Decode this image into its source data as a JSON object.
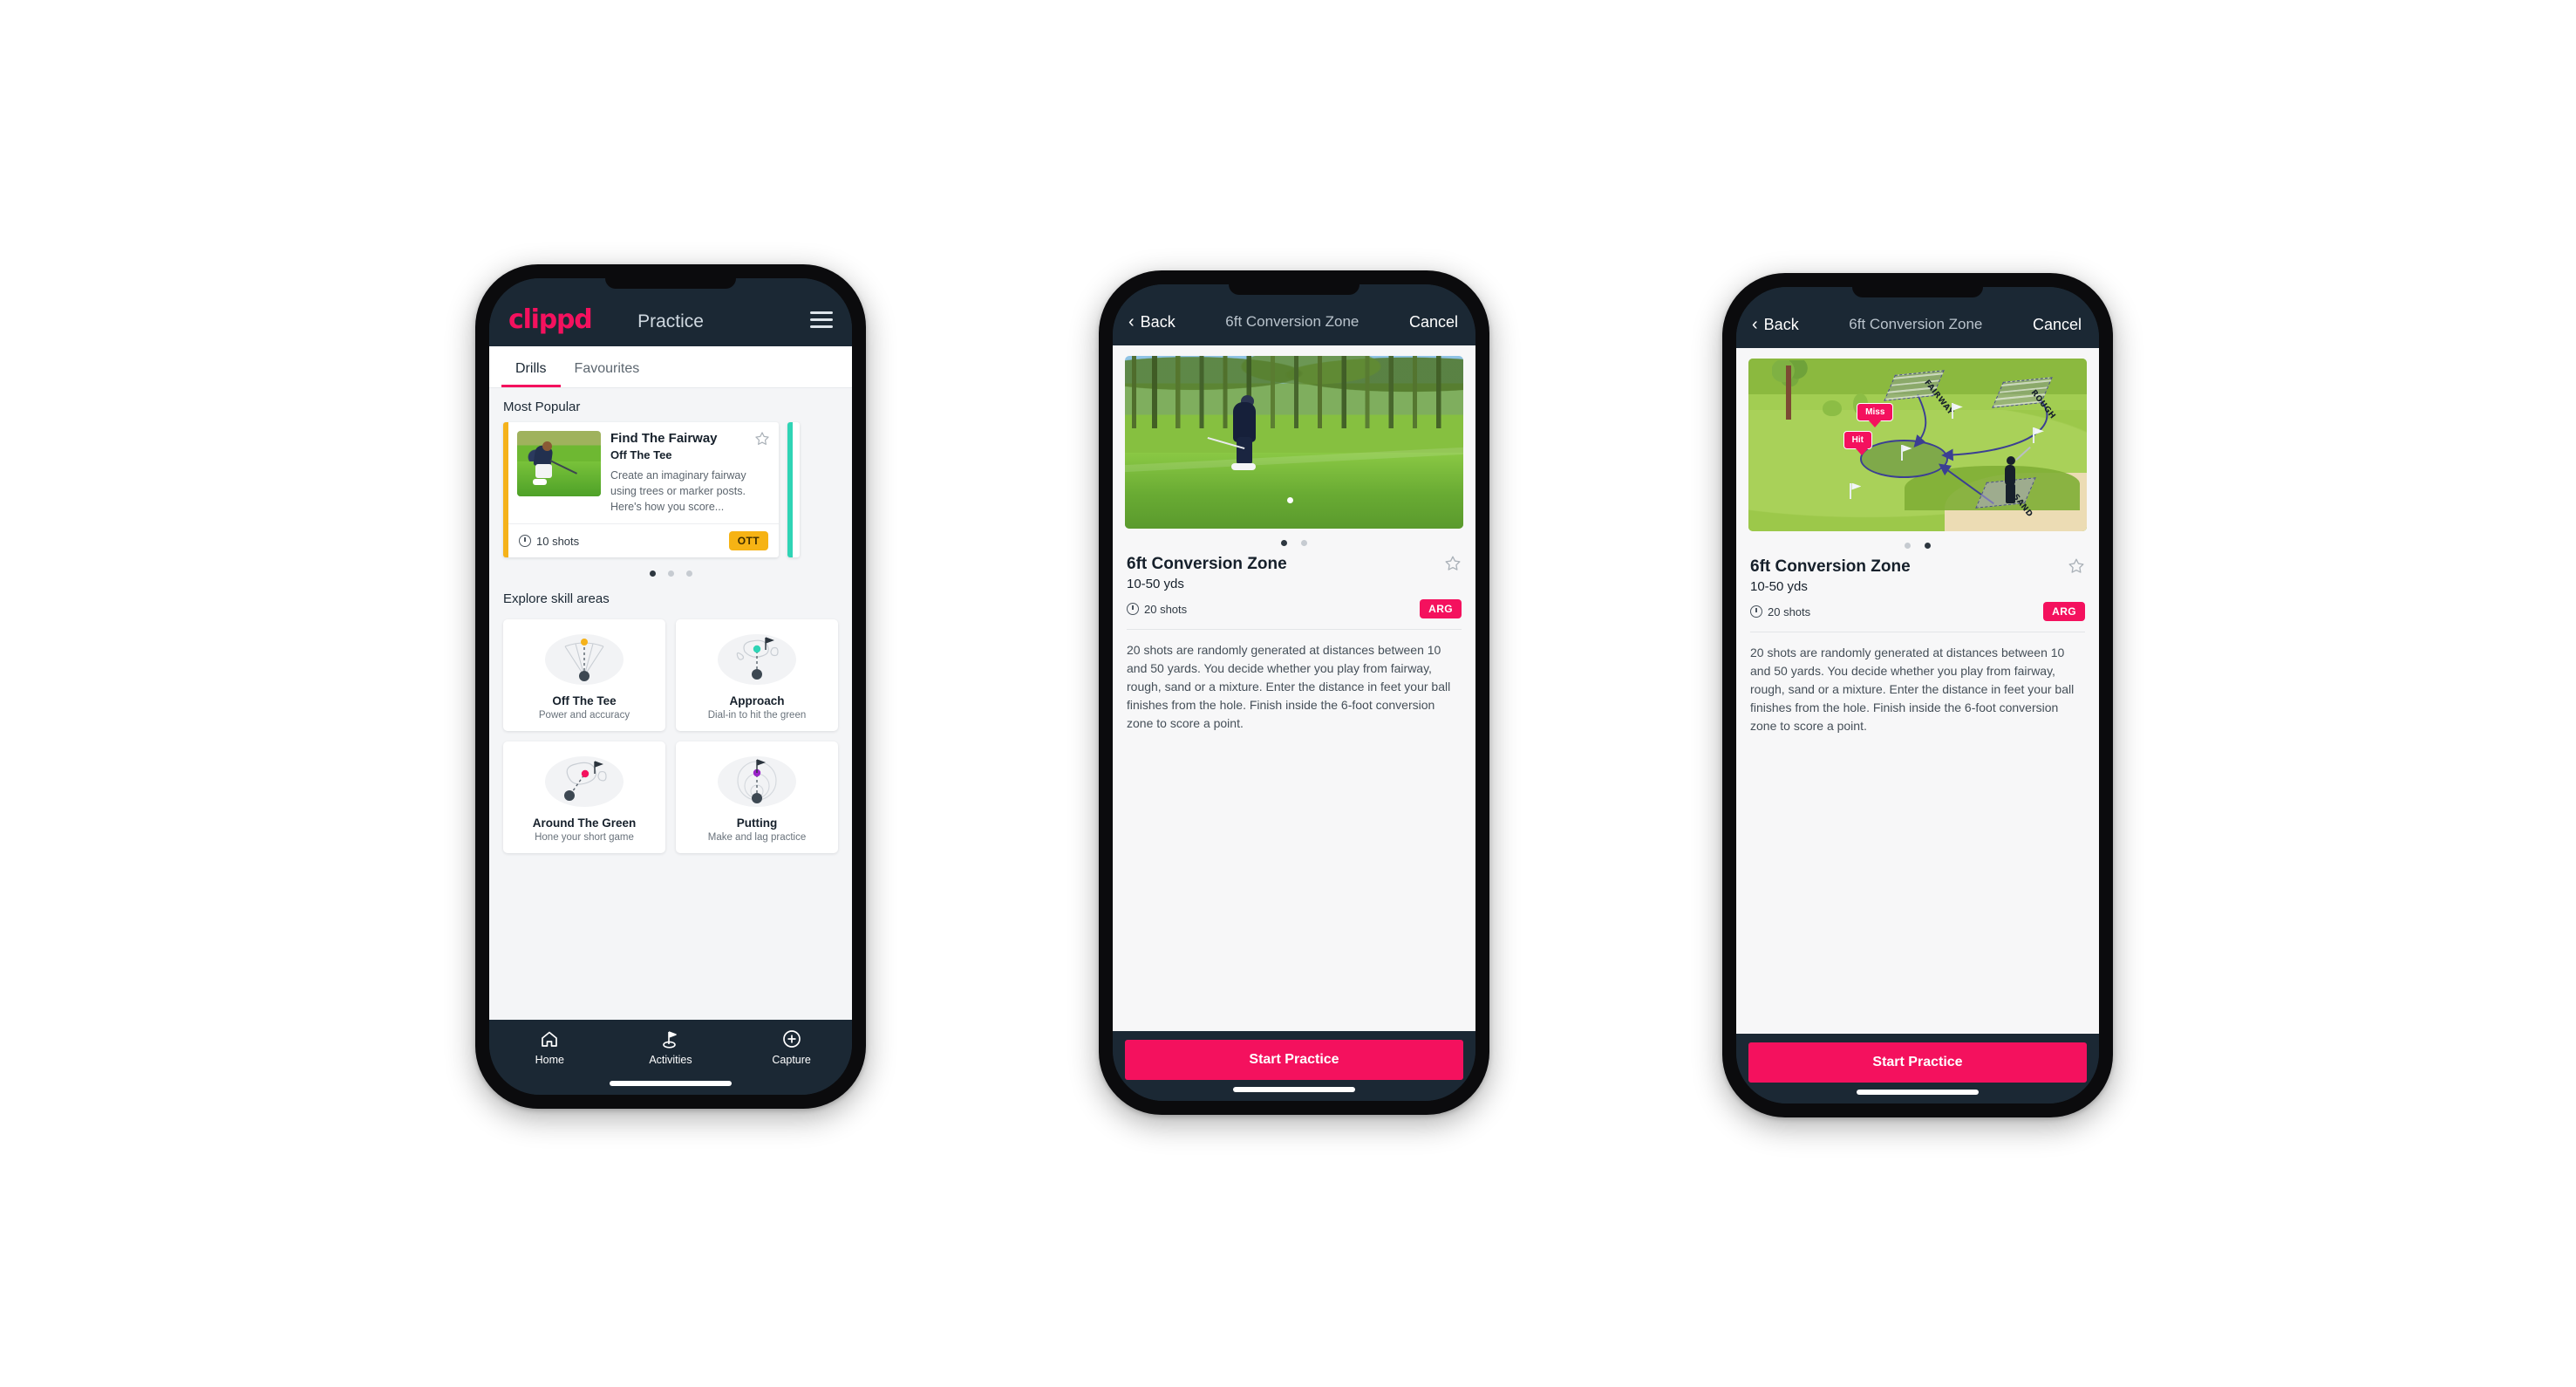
{
  "app": {
    "brand": "clippd",
    "accent": "#f4115e",
    "dark": "#1b2834"
  },
  "phone1": {
    "header": {
      "logo": "clippd",
      "title": "Practice",
      "menu_icon": "hamburger-icon"
    },
    "tabs": [
      {
        "label": "Drills",
        "active": true
      },
      {
        "label": "Favourites",
        "active": false
      }
    ],
    "most_popular": {
      "section_label": "Most Popular",
      "card": {
        "title": "Find The Fairway",
        "subtitle": "Off The Tee",
        "description": "Create an imaginary fairway using trees or marker posts. Here's how you score...",
        "shots": "10 shots",
        "chip": "OTT",
        "chip_color": "#f6b314",
        "accent_bar": "#f5b21a",
        "next_accent_bar": "#2ed4b5",
        "favourite_icon": "star-outline-icon",
        "shots_icon": "clock-icon"
      },
      "dots": [
        true,
        false,
        false
      ]
    },
    "explore": {
      "section_label": "Explore skill areas",
      "cards": [
        {
          "name": "Off The Tee",
          "desc": "Power and accuracy",
          "icon": "tee-fan-icon",
          "dot_color": "#f5b21a"
        },
        {
          "name": "Approach",
          "desc": "Dial-in to hit the green",
          "icon": "approach-green-icon",
          "dot_color": "#2ed4b5"
        },
        {
          "name": "Around The Green",
          "desc": "Hone your short game",
          "icon": "around-green-icon",
          "dot_color": "#f4115e"
        },
        {
          "name": "Putting",
          "desc": "Make and lag practice",
          "icon": "putting-rings-icon",
          "dot_color": "#9b23c9"
        }
      ]
    },
    "bottom_nav": [
      {
        "label": "Home",
        "icon": "home-icon",
        "active": false
      },
      {
        "label": "Activities",
        "icon": "golf-flag-icon",
        "active": true
      },
      {
        "label": "Capture",
        "icon": "plus-circle-icon",
        "active": false
      }
    ]
  },
  "phone2": {
    "nav": {
      "back": "Back",
      "back_icon": "chevron-left-icon",
      "title": "6ft Conversion Zone",
      "cancel": "Cancel"
    },
    "media_type": "photo",
    "dots": [
      true,
      false
    ],
    "drill": {
      "title": "6ft Conversion Zone",
      "distance": "10-50 yds",
      "shots": "20 shots",
      "shots_icon": "clock-icon",
      "chip": "ARG",
      "chip_color": "#f4115e",
      "favourite_icon": "star-outline-icon",
      "description": "20 shots are randomly generated at distances between 10 and 50 yards. You decide whether you play from fairway, rough, sand or a mixture. Enter the distance in feet your ball finishes from the hole. Finish inside the 6-foot conversion zone to score a point."
    },
    "cta": "Start Practice"
  },
  "phone3": {
    "nav": {
      "back": "Back",
      "back_icon": "chevron-left-icon",
      "title": "6ft Conversion Zone",
      "cancel": "Cancel"
    },
    "media_type": "illustration",
    "illustration": {
      "labels": [
        "FAIRWAY",
        "ROUGH",
        "SAND"
      ],
      "callouts": [
        "Miss",
        "Hit"
      ]
    },
    "dots": [
      false,
      true
    ],
    "drill": {
      "title": "6ft Conversion Zone",
      "distance": "10-50 yds",
      "shots": "20 shots",
      "shots_icon": "clock-icon",
      "chip": "ARG",
      "chip_color": "#f4115e",
      "favourite_icon": "star-outline-icon",
      "description": "20 shots are randomly generated at distances between 10 and 50 yards. You decide whether you play from fairway, rough, sand or a mixture. Enter the distance in feet your ball finishes from the hole. Finish inside the 6-foot conversion zone to score a point."
    },
    "cta": "Start Practice"
  }
}
